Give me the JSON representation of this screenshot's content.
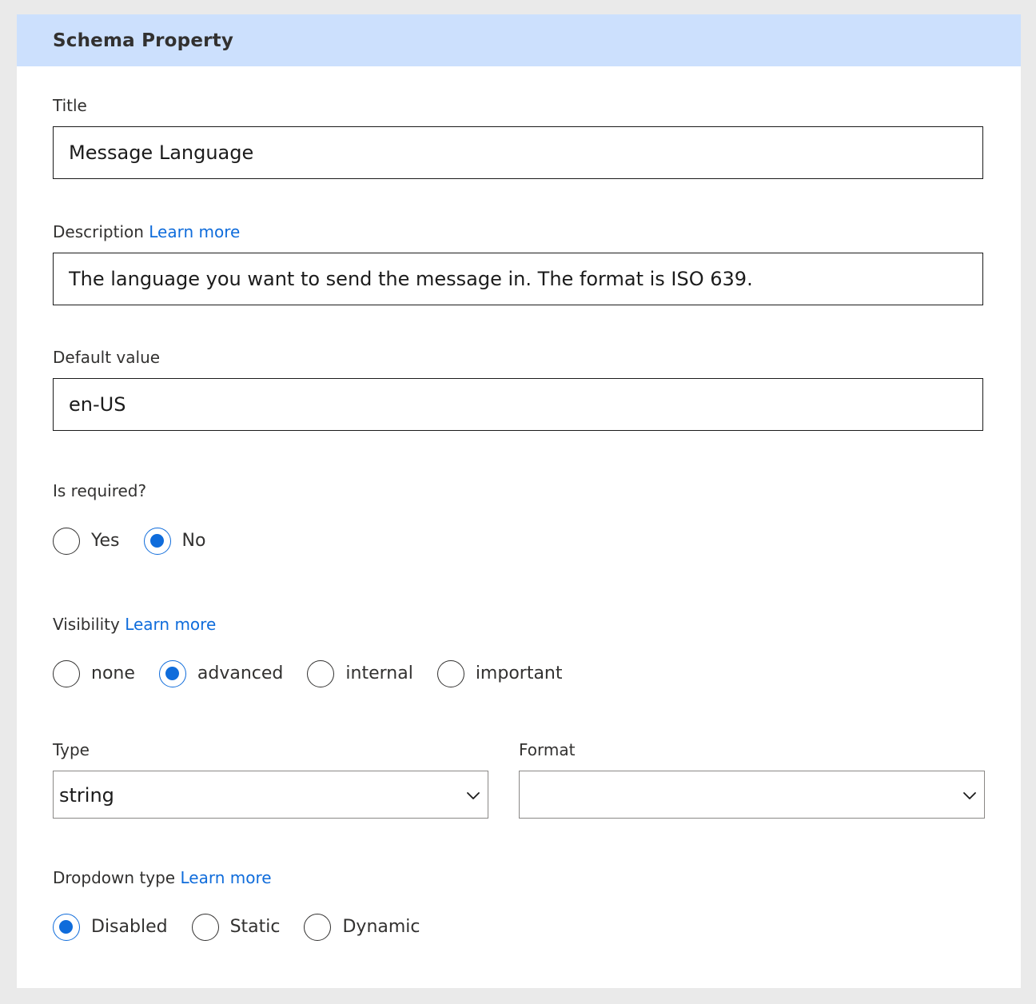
{
  "panel": {
    "title": "Schema Property"
  },
  "title_field": {
    "label": "Title",
    "value": "Message Language"
  },
  "description_field": {
    "label": "Description",
    "link": "Learn more",
    "value": "The language you want to send the message in. The format is ISO 639."
  },
  "default_value_field": {
    "label": "Default value",
    "value": "en-US"
  },
  "is_required": {
    "label": "Is required?",
    "options": [
      {
        "label": "Yes",
        "checked": false
      },
      {
        "label": "No",
        "checked": true
      }
    ]
  },
  "visibility": {
    "label": "Visibility",
    "link": "Learn more",
    "options": [
      {
        "label": "none",
        "checked": false
      },
      {
        "label": "advanced",
        "checked": true
      },
      {
        "label": "internal",
        "checked": false
      },
      {
        "label": "important",
        "checked": false
      }
    ]
  },
  "type_select": {
    "label": "Type",
    "selected": "string"
  },
  "format_select": {
    "label": "Format",
    "selected": ""
  },
  "dropdown_type": {
    "label": "Dropdown type",
    "link": "Learn more",
    "options": [
      {
        "label": "Disabled",
        "checked": true
      },
      {
        "label": "Static",
        "checked": false
      },
      {
        "label": "Dynamic",
        "checked": false
      }
    ]
  },
  "colors": {
    "header_bg": "#cce0fd",
    "accent": "#0f6cdb",
    "text": "#323130",
    "page_bg": "#eaeaea"
  },
  "icons": {
    "select_chevron": "chevron-down-icon"
  }
}
